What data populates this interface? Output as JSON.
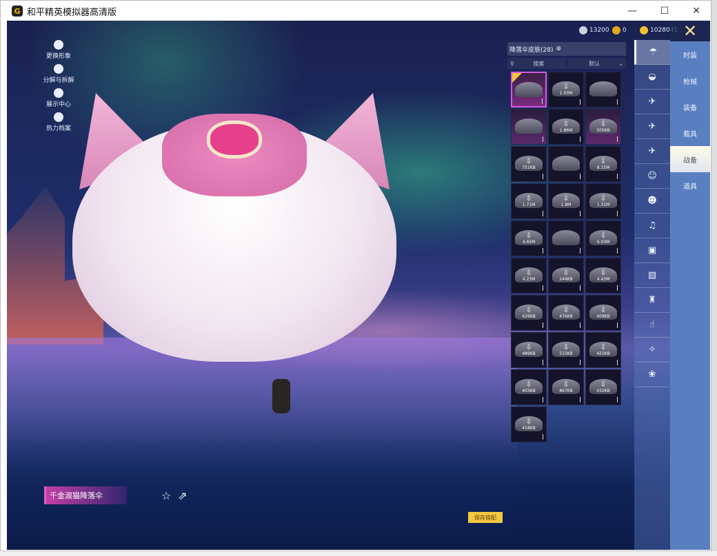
{
  "window": {
    "title": "和平精英模拟器高清版",
    "minimize": "—",
    "maximize": "☐",
    "close": "✕"
  },
  "left_menu": [
    {
      "label": "更换形象",
      "icon": "avatar-icon"
    },
    {
      "label": "分解与拆解",
      "icon": "puzzle-icon"
    },
    {
      "label": "展示中心",
      "icon": "eye-icon"
    },
    {
      "label": "热力档案",
      "icon": "flame-icon"
    }
  ],
  "currency": [
    {
      "icon": "silver-coin-icon",
      "value": "13200",
      "color": "#c9d0e0"
    },
    {
      "icon": "gold-medal-icon",
      "value": "0",
      "color": "#e0a820"
    },
    {
      "icon": "gold-coin-icon",
      "value": "1028041",
      "color": "#f0c030"
    }
  ],
  "close_game": "✕",
  "panel": {
    "title": "降落伞皮肤(28)",
    "search_placeholder": "搜索",
    "sort": "默认"
  },
  "items": [
    {
      "size": "",
      "state": "selected"
    },
    {
      "size": "1.03M",
      "state": ""
    },
    {
      "size": "",
      "state": ""
    },
    {
      "size": "",
      "state": "purple"
    },
    {
      "size": "1.86M",
      "state": ""
    },
    {
      "size": "505KB",
      "state": "purple"
    },
    {
      "size": "751KB",
      "state": ""
    },
    {
      "size": "",
      "state": ""
    },
    {
      "size": "8.15M",
      "state": ""
    },
    {
      "size": "1.71M",
      "state": ""
    },
    {
      "size": "1.8M",
      "state": ""
    },
    {
      "size": "1.31M",
      "state": ""
    },
    {
      "size": "4.65M",
      "state": ""
    },
    {
      "size": "",
      "state": ""
    },
    {
      "size": "6.03M",
      "state": ""
    },
    {
      "size": "4.23M",
      "state": ""
    },
    {
      "size": "244KB",
      "state": ""
    },
    {
      "size": "4.43M",
      "state": ""
    },
    {
      "size": "429KB",
      "state": ""
    },
    {
      "size": "476KB",
      "state": ""
    },
    {
      "size": "409KB",
      "state": ""
    },
    {
      "size": "489KB",
      "state": ""
    },
    {
      "size": "515KB",
      "state": ""
    },
    {
      "size": "425KB",
      "state": ""
    },
    {
      "size": "403KB",
      "state": ""
    },
    {
      "size": "867KB",
      "state": ""
    },
    {
      "size": "432KB",
      "state": ""
    },
    {
      "size": "418KB",
      "state": ""
    }
  ],
  "icon_column": [
    "parachute-icon",
    "backpack-icon",
    "helmet-icon",
    "vehicle-icon",
    "plane-icon",
    "emote-icon",
    "robot-icon",
    "sound-icon",
    "card-icon",
    "photo-icon",
    "spray-icon",
    "gesture-icon",
    "magic-icon",
    "pet-icon"
  ],
  "icon_glyphs": [
    "☂",
    "◒",
    "✈",
    "✈",
    "✈",
    "☺",
    "☻",
    "♫",
    "▣",
    "▨",
    "♜",
    "☝",
    "✧",
    "❀"
  ],
  "tabs": [
    {
      "label": "时装"
    },
    {
      "label": "枪械"
    },
    {
      "label": "装备"
    },
    {
      "label": "载具"
    },
    {
      "label": "战备",
      "active": true
    },
    {
      "label": "道具"
    }
  ],
  "item_name": "千金淑猫降落伞",
  "favorite": "☆",
  "share": "⇗",
  "save_button": "保存搭配",
  "download_glyph": "⇩"
}
